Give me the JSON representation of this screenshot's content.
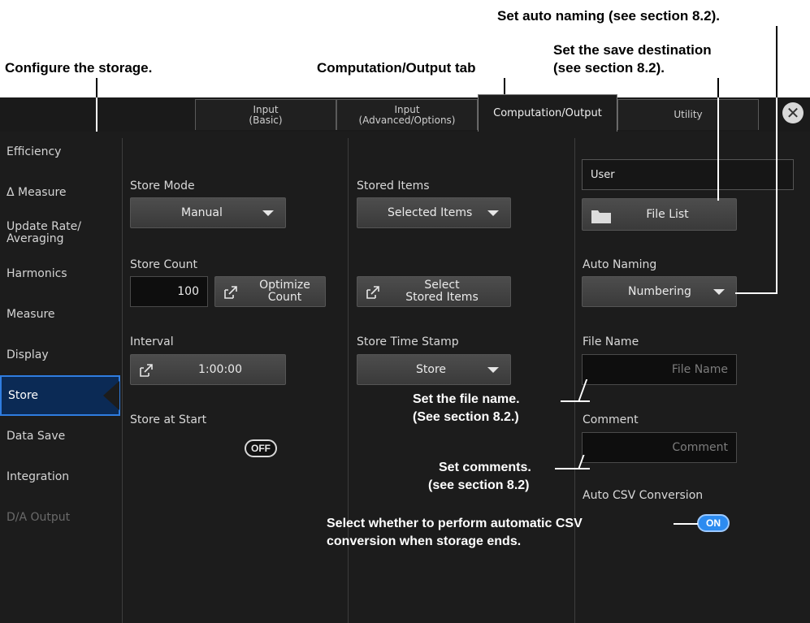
{
  "callouts": {
    "configure_storage": "Configure the storage.",
    "computation_tab": "Computation/Output tab",
    "auto_naming": "Set auto naming (see section 8.2).",
    "save_dest_line1": "Set the save destination",
    "save_dest_line2": "(see section 8.2).",
    "file_name_line1": "Set the file name.",
    "file_name_line2": "(See section 8.2.)",
    "comments_line1": "Set comments.",
    "comments_line2": "(see section 8.2)",
    "csv_line1": "Select whether to perform automatic CSV",
    "csv_line2": "conversion when storage ends."
  },
  "tabs": [
    {
      "line1": "Input",
      "line2": "(Basic)"
    },
    {
      "line1": "Input",
      "line2": "(Advanced/Options)"
    },
    {
      "line1": "Computation/Output",
      "line2": ""
    },
    {
      "line1": "Utility",
      "line2": ""
    }
  ],
  "close_glyph": "✕",
  "sidebar": {
    "items": [
      {
        "label": "Efficiency"
      },
      {
        "label": "Δ Measure"
      },
      {
        "label": "Update Rate/\nAveraging"
      },
      {
        "label": "Harmonics"
      },
      {
        "label": "Measure"
      },
      {
        "label": "Display"
      },
      {
        "label": "Store"
      },
      {
        "label": "Data Save"
      },
      {
        "label": "Integration"
      },
      {
        "label": "D/A Output"
      }
    ]
  },
  "col1": {
    "store_mode_label": "Store Mode",
    "store_mode_value": "Manual",
    "store_count_label": "Store Count",
    "store_count_value": "100",
    "optimize_line1": "Optimize",
    "optimize_line2": "Count",
    "interval_label": "Interval",
    "interval_value": "1:00:00",
    "store_at_start_label": "Store at Start",
    "store_at_start_state": "OFF"
  },
  "col2": {
    "stored_items_label": "Stored Items",
    "stored_items_value": "Selected Items",
    "select_line1": "Select",
    "select_line2": "Stored Items",
    "time_stamp_label": "Store Time Stamp",
    "time_stamp_value": "Store"
  },
  "col3": {
    "path_value": "User",
    "file_list_label": "File List",
    "auto_naming_label": "Auto Naming",
    "auto_naming_value": "Numbering",
    "file_name_label": "File Name",
    "file_name_placeholder": "File Name",
    "comment_label": "Comment",
    "comment_placeholder": "Comment",
    "csv_label": "Auto CSV Conversion",
    "csv_state": "ON"
  }
}
